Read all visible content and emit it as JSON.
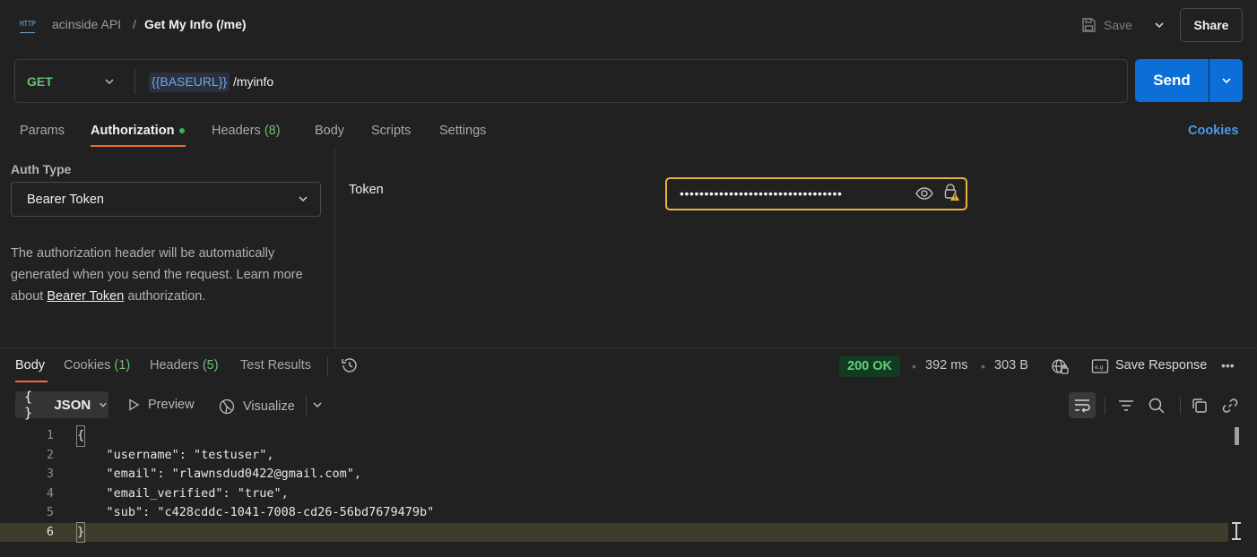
{
  "header": {
    "app_icon": "http-icon",
    "app_icon_text": "HTTP",
    "collection": "acinside API",
    "separator": "/",
    "request_title": "Get My Info (/me)",
    "save_label": "Save",
    "share_label": "Share"
  },
  "url_bar": {
    "method": "GET",
    "base_variable": "{{BASEURL}}",
    "path": "/myinfo",
    "send_label": "Send"
  },
  "request_tabs": [
    {
      "label": "Params",
      "count": ""
    },
    {
      "label": "Authorization",
      "count": ""
    },
    {
      "label": "Headers",
      "count": "(8)"
    },
    {
      "label": "Body",
      "count": ""
    },
    {
      "label": "Scripts",
      "count": ""
    },
    {
      "label": "Settings",
      "count": ""
    }
  ],
  "active_request_tab": "Authorization",
  "cookies_link": "Cookies",
  "auth": {
    "type_label": "Auth Type",
    "type_value": "Bearer Token",
    "description_prefix": "The authorization header will be automatically generated when you send the request. Learn more about ",
    "description_link": "Bearer Token",
    "description_suffix": " authorization.",
    "token_label": "Token",
    "token_masked": "•••••••••••••••••••••••••••••••••"
  },
  "response_tabs": [
    {
      "label": "Body",
      "count": ""
    },
    {
      "label": "Cookies",
      "count": "(1)"
    },
    {
      "label": "Headers",
      "count": "(5)"
    },
    {
      "label": "Test Results",
      "count": ""
    }
  ],
  "active_response_tab": "Body",
  "response_meta": {
    "status": "200 OK",
    "time": "392 ms",
    "size": "303 B",
    "save_response": "Save Response",
    "more": "•••"
  },
  "format_toolbar": {
    "format_braces": "{ }",
    "format": "JSON",
    "preview": "Preview",
    "visualize": "Visualize"
  },
  "code": {
    "line_numbers": [
      "1",
      "2",
      "3",
      "4",
      "5",
      "6"
    ],
    "lines": [
      "{",
      "    \"username\": \"testuser\",",
      "    \"email\": \"rlawnsdud0422@gmail.com\",",
      "    \"email_verified\": \"true\",",
      "    \"sub\": \"c428cddc-1041-7008-cd26-56bd7679479b\"",
      "}"
    ],
    "current_line": 6
  },
  "colors": {
    "background": "#212121",
    "accent_orange": "#f26b3a",
    "send_blue": "#0c6fd8",
    "status_green": "#5fd07a",
    "token_border": "#e8b43c",
    "variable_blue": "#71a7e6"
  }
}
